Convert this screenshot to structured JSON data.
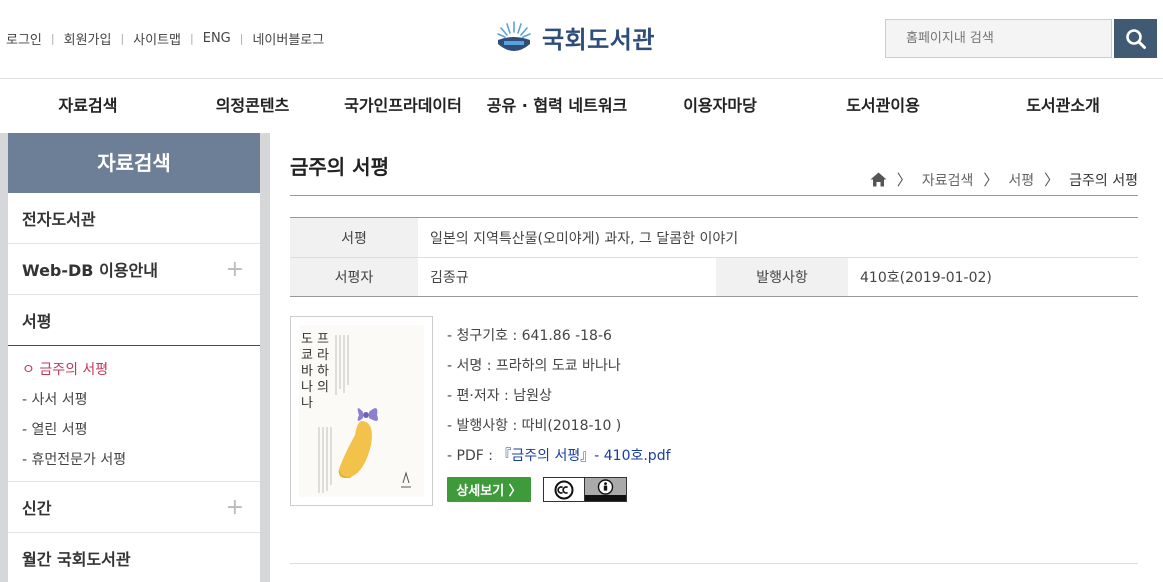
{
  "header": {
    "util_links": [
      "로그인",
      "회원가입",
      "사이트맵",
      "ENG",
      "네이버블로그"
    ],
    "logo_text": "국회도서관",
    "search_placeholder": "홈페이지내 검색",
    "search_icon": "search-icon",
    "brand_color": "#2f4d7a"
  },
  "gnb": {
    "items": [
      "자료검색",
      "의정콘텐츠",
      "국가인프라데이터",
      "공유 · 협력 네트워크",
      "이용자마당",
      "도서관이용",
      "도서관소개"
    ]
  },
  "sidebar": {
    "title": "자료검색",
    "items": [
      {
        "label": "전자도서관"
      },
      {
        "label": "Web-DB 이용안내",
        "expand": "+"
      },
      {
        "label": "서평"
      },
      {
        "label": "신간",
        "expand": "+"
      },
      {
        "label": "월간 국회도서관"
      }
    ],
    "sub_items": [
      "ㅇ 금주의 서평",
      "- 사서 서평",
      "- 열린 서평",
      "- 휴먼전문가 서평"
    ]
  },
  "content": {
    "title": "금주의 서평",
    "breadcrumb": [
      "자료검색",
      "서평",
      "금주의 서평"
    ],
    "table": {
      "review_label": "서평",
      "review_value": "일본의 지역특산물(오미야게) 과자, 그 달콤한 이야기",
      "reviewer_label": "서평자",
      "reviewer_value": "김종규",
      "issue_label": "발행사항",
      "issue_value": "410호(2019-01-02)"
    },
    "book": {
      "cover_title": "프라하의 도쿄 바나나",
      "call_number": "- 청구기호 : 641.86 -18-6",
      "name": "- 서명 : 프라하의 도쿄 바나나",
      "author": "- 편·저자 : 남원상",
      "publication": "- 발행사항 : 따비(2018-10 )",
      "pdf_label": "- PDF : ",
      "pdf_link": "『금주의 서평』- 410호.pdf",
      "detail_button": "상세보기 〉",
      "cc_icon": "cc-by-license-icon"
    }
  }
}
